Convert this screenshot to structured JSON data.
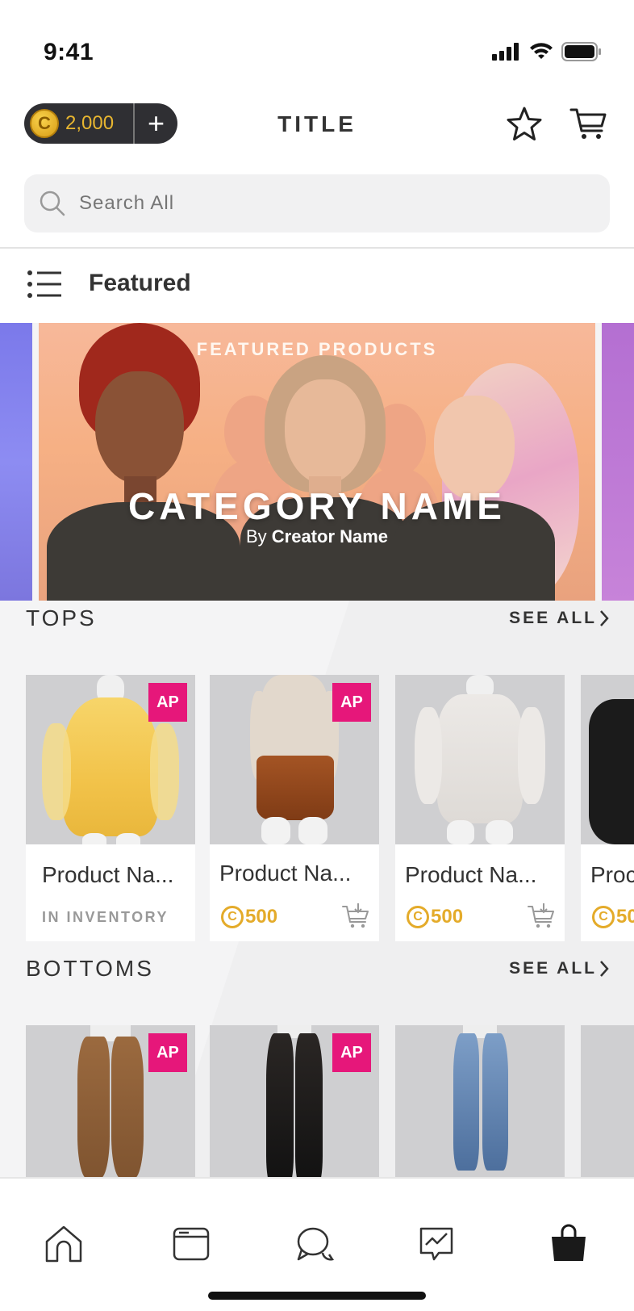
{
  "status_bar": {
    "time": "9:41"
  },
  "header": {
    "coins": "2,000",
    "coin_symbol": "C",
    "add_label": "+",
    "title": "TITLE"
  },
  "search": {
    "placeholder": "Search All"
  },
  "category_nav": {
    "label": "Featured"
  },
  "banner": {
    "label": "FEATURED PRODUCTS",
    "title": "CATEGORY NAME",
    "by_prefix": "By",
    "creator": "Creator Name"
  },
  "sections": [
    {
      "title": "TOPS",
      "see_all": "SEE ALL",
      "products": [
        {
          "name": "Product Na...",
          "badge": "AP",
          "status": "IN INVENTORY",
          "price": ""
        },
        {
          "name": "Product Na...",
          "badge": "AP",
          "status": "",
          "price": "500"
        },
        {
          "name": "Product Na...",
          "badge": "",
          "status": "",
          "price": "500"
        },
        {
          "name": "Proc",
          "badge": "",
          "status": "",
          "price": "50"
        }
      ]
    },
    {
      "title": "BOTTOMS",
      "see_all": "SEE ALL",
      "products": [
        {
          "badge": "AP"
        },
        {
          "badge": "AP"
        },
        {
          "badge": ""
        },
        {
          "badge": ""
        }
      ]
    }
  ],
  "price_coin_symbol": "C",
  "tabs": [
    "home-icon",
    "browser-icon",
    "chat-icon",
    "activity-icon",
    "shop-bag-icon"
  ],
  "colors": {
    "accent_badge": "#e6177a",
    "coin_gold": "#e4ab2a",
    "header_pill": "#2f2f33"
  }
}
